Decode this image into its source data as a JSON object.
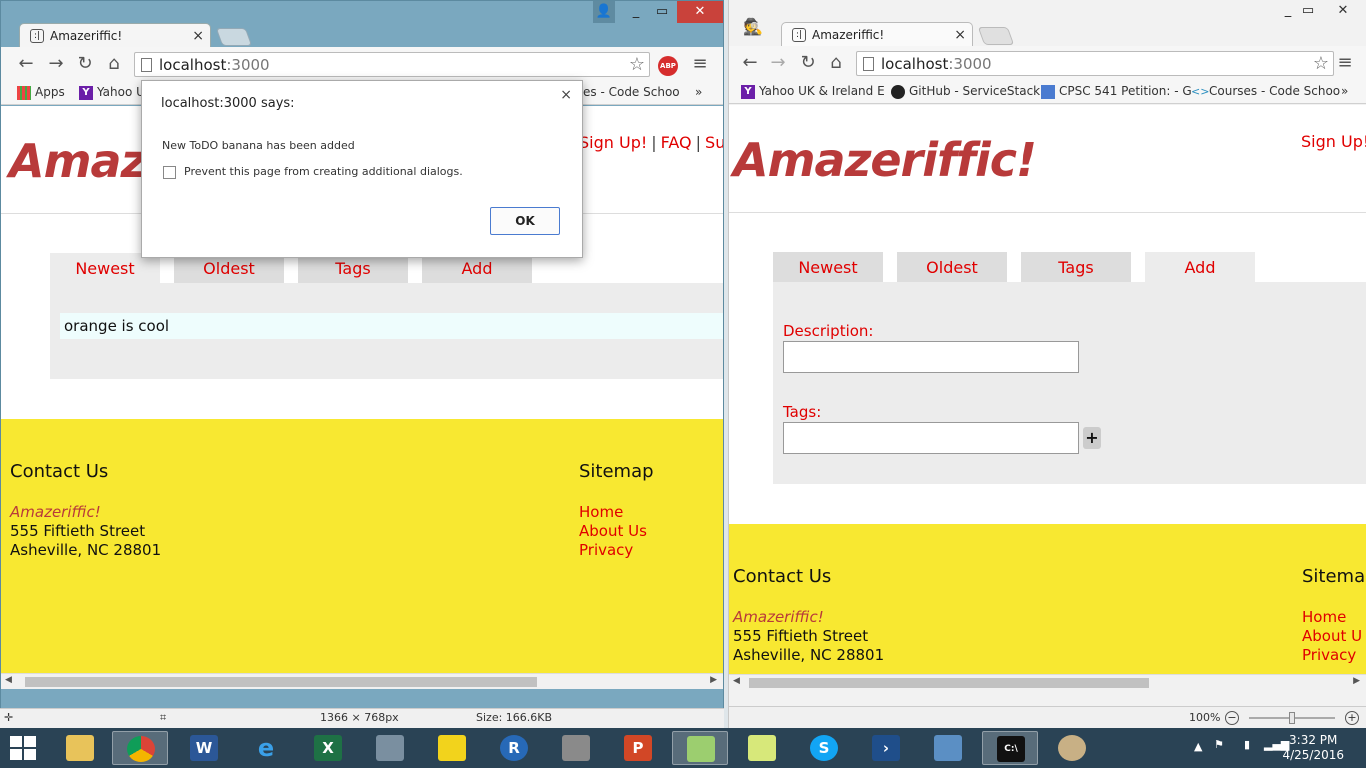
{
  "left_window": {
    "tab_title": "Amazeriffic!",
    "url_host": "localhost",
    "url_port": ":3000",
    "adblock_label": "ABP",
    "bookmarks": [
      "Apps",
      "Yahoo U",
      "es - Code Schoo"
    ],
    "bookmark_overflow": "»",
    "brand_partial": "Amaze",
    "nav": [
      "Sign Up!",
      "|",
      "FAQ",
      "|",
      "Su"
    ],
    "tabs": [
      "Newest",
      "Oldest",
      "Tags",
      "Add"
    ],
    "active_tab": "Newest",
    "todo_items": [
      "orange is cool"
    ],
    "status": {
      "dimensions": "1366 × 768px",
      "size": "Size: 166.6KB"
    }
  },
  "dialog": {
    "title": "localhost:3000 says:",
    "message": "New ToDO banana has been added",
    "checkbox_label": "Prevent this page from creating additional dialogs.",
    "ok_label": "OK",
    "close": "×"
  },
  "right_window": {
    "tab_title": "Amazeriffic!",
    "url_host": "localhost",
    "url_port": ":3000",
    "bookmarks": [
      "Yahoo UK & Ireland E",
      "GitHub - ServiceStack",
      "CPSC 541 Petition: - G",
      "Courses - Code Schoo"
    ],
    "bookmark_overflow": "»",
    "brand": "Amazeriffic!",
    "nav": [
      "Sign Up!"
    ],
    "tabs": [
      "Newest",
      "Oldest",
      "Tags",
      "Add"
    ],
    "active_tab": "Add",
    "form": {
      "description_label": "Description:",
      "description_value": "",
      "tags_label": "Tags:",
      "tags_value": "",
      "add_button": "+"
    },
    "status": {
      "zoom": "100%"
    }
  },
  "footer": {
    "contact_heading": "Contact Us",
    "contact_brand": "Amazeriffic!",
    "address_line1": "555 Fiftieth Street",
    "address_line2": "Asheville, NC 28801",
    "sitemap_heading": "Sitemap",
    "sitemap_heading_partial": "Sitema",
    "links": [
      "Home",
      "About Us",
      "Privacy"
    ],
    "about_partial": "About U"
  },
  "taskbar": {
    "apps": [
      "file-explorer-icon",
      "chrome-icon",
      "word-icon",
      "internet-explorer-icon",
      "excel-icon",
      "calculator-icon",
      "game-icon",
      "r-icon",
      "snipping-tool-icon",
      "powerpoint-icon",
      "notepad-plus-plus-icon",
      "sticky-notes-icon",
      "skype-icon",
      "powershell-icon",
      "remote-desktop-icon",
      "cmd-icon",
      "paint-icon"
    ],
    "app_labels": {
      "word": "W",
      "excel": "X",
      "powerpoint": "P",
      "r": "R",
      "cmd": "C:\\"
    },
    "time": "3:32 PM",
    "date": "4/25/2016"
  },
  "colors": {
    "brand_red": "#b83a3a",
    "link_red": "#e00000",
    "footer_yellow": "#f8e831",
    "panel_gray": "#ececec",
    "taskbar": "#2a4355"
  }
}
